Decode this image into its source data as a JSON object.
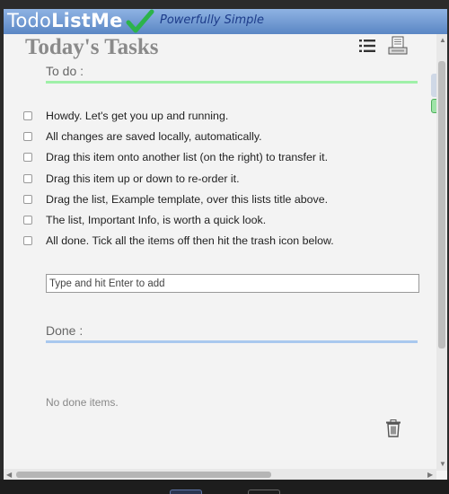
{
  "header": {
    "logo_part1": "Todo",
    "logo_part2": "ListMe",
    "tagline": "Powerfully Simple"
  },
  "list": {
    "title": "Today's Tasks",
    "todo_label": "To do :",
    "done_label": "Done :",
    "items": [
      "Howdy. Let's get you up and running.",
      "All changes are saved locally, automatically.",
      "Drag this item onto another list (on the right) to transfer it.",
      "Drag this item up or down to re-order it.",
      "Drag the list, Example template, over this lists title above.",
      "The list, Important Info, is worth a quick look.",
      "All done. Tick all the items off then hit the trash icon below."
    ],
    "add_placeholder": "Type and hit Enter to add",
    "no_done_text": "No done items."
  },
  "colors": {
    "header_blue": "#6f97d2",
    "todo_rule": "#9ff0a8",
    "done_rule": "#a9c8ee",
    "title_gray": "#8a8a8a"
  },
  "icons": [
    "check-logo-icon",
    "list-view-icon",
    "print-icon",
    "trash-icon"
  ]
}
